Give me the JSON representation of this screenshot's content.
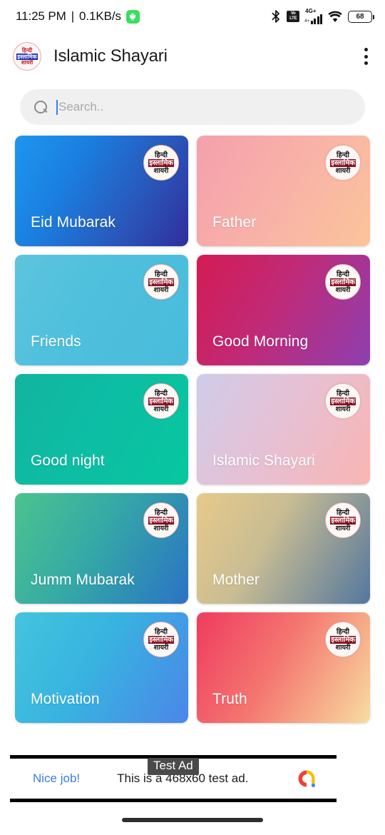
{
  "status_bar": {
    "time": "11:25 PM",
    "separator": "|",
    "network_speed": "0.1KB/s",
    "speed_badge_icon": "android-robot-icon",
    "bluetooth_icon": "bluetooth-icon",
    "volte_label_top": "Vo",
    "volte_label_bottom": "LTE",
    "network_type": "4G+",
    "network_sub": "4+",
    "wifi_icon": "wifi-icon",
    "battery_level": "68"
  },
  "app_bar": {
    "logo": {
      "icon": "app-logo-icon",
      "line1": "हिन्दी",
      "line2": "इस्लामिक",
      "line3": "शायरी"
    },
    "title": "Islamic Shayari",
    "overflow_icon": "more-vertical-icon"
  },
  "search": {
    "icon": "search-icon",
    "value": "",
    "placeholder": "Search.."
  },
  "badge": {
    "line1": "हिन्दी",
    "line2": "इस्लामिक",
    "line3": "शायरी"
  },
  "categories": [
    {
      "title": "Eid Mubarak",
      "gradient": "linear-gradient(120deg,#1e96ef 0%,#1a7fe0 32%,#2a55b8 70%,#2f2e9e 100%)"
    },
    {
      "title": "Father",
      "gradient": "linear-gradient(120deg,#f4a0ac 0%,#f8b0a8 45%,#fbc49b 100%)"
    },
    {
      "title": "Friends",
      "gradient": "linear-gradient(120deg,#5ec4dd 0%,#4fc0dd 40%,#48bcdb 100%)"
    },
    {
      "title": "Good Morning",
      "gradient": "linear-gradient(120deg,#d41b54 0%,#c02a77 45%,#8e3fb0 100%)"
    },
    {
      "title": "Good night",
      "gradient": "linear-gradient(120deg,#12b49f 0%,#0dbda4 45%,#07c79e 100%)"
    },
    {
      "title": "Islamic Shayari",
      "gradient": "linear-gradient(120deg,#cfcce8 0%,#e3c2d8 40%,#f9b5b3 100%)"
    },
    {
      "title": "Jumm Mubarak",
      "gradient": "linear-gradient(120deg,#4cc38e 0%,#35a9a6 45%,#2a73c4 100%)"
    },
    {
      "title": "Mother",
      "gradient": "linear-gradient(120deg,#e8c98a 0%,#c9bd93 40%,#54779e 100%)"
    },
    {
      "title": "Motivation",
      "gradient": "linear-gradient(120deg,#44c4dd 0%,#38b3e0 45%,#4b86e8 100%)"
    },
    {
      "title": "Truth",
      "gradient": "linear-gradient(120deg,#ef3b5f 0%,#f4756f 45%,#f8dca0 100%)"
    }
  ],
  "ad": {
    "label": "Test Ad",
    "cta": "Nice job!",
    "body": "This is a 468x60 test ad.",
    "logo_icon": "admob-logo-icon"
  },
  "nav": {
    "pill_icon": "home-gesture-pill"
  }
}
